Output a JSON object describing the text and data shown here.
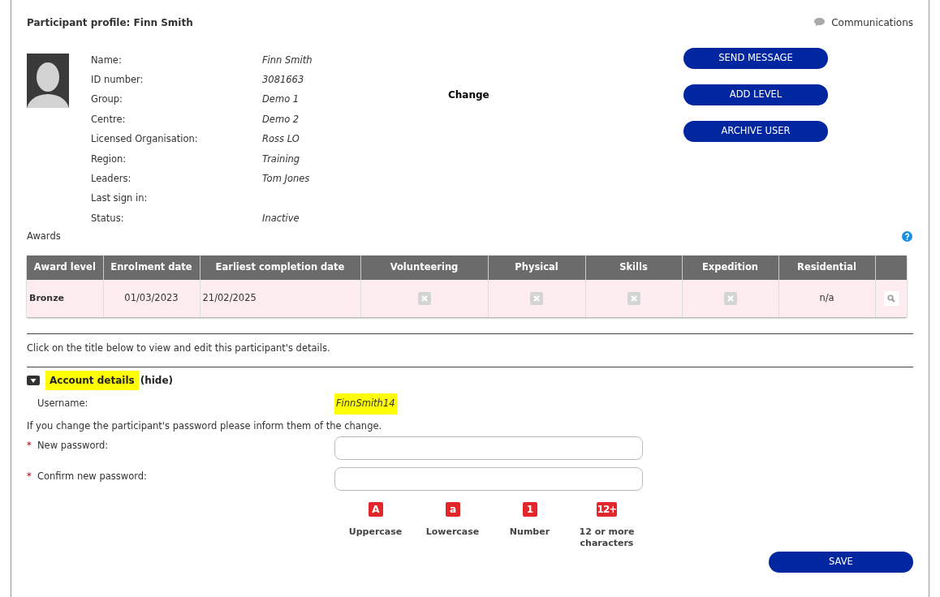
{
  "header": {
    "title": "Participant profile: Finn Smith",
    "communications": "Communications"
  },
  "profile": {
    "fields": [
      {
        "label": "Name:",
        "value": "Finn Smith"
      },
      {
        "label": "ID number:",
        "value": "3081663"
      },
      {
        "label": "Group:",
        "value": "Demo 1"
      },
      {
        "label": "Centre:",
        "value": "Demo 2"
      },
      {
        "label": "Licensed Organisation:",
        "value": "Ross LO"
      },
      {
        "label": "Region:",
        "value": "Training"
      },
      {
        "label": "Leaders:",
        "value": "Tom Jones"
      },
      {
        "label": "Last sign in:"
      },
      {
        "label": "Status:",
        "value": "Inactive"
      }
    ],
    "change_link": "Change",
    "buttons": [
      "SEND MESSAGE",
      "ADD LEVEL",
      "ARCHIVE USER"
    ]
  },
  "awards": {
    "title": "Awards",
    "columns": [
      "Award level",
      "Enrolment date",
      "Earliest completion date",
      "Volunteering",
      "Physical",
      "Skills",
      "Expedition",
      "Residential"
    ],
    "rows": [
      {
        "level": "Bronze",
        "enrolment": "01/03/2023",
        "earliest": "21/02/2025",
        "sections": [
          {
            "done": false
          },
          {
            "done": false
          },
          {
            "done": false
          },
          {
            "done": false
          }
        ],
        "residential": "n/a"
      }
    ]
  },
  "instructions": "Click on the title below to view and edit this participant's details.",
  "account": {
    "title": "Account details",
    "toggle": "(hide)",
    "expanded": true,
    "username_label": "Username:",
    "username": "FinnSmith14",
    "note": "If you change the participant's password please inform them of the change.",
    "fields": [
      {
        "marker": "*",
        "label": "New password:"
      },
      {
        "marker": "*",
        "label": "Confirm new password:"
      }
    ],
    "rules": [
      {
        "badge": "A",
        "label": "Uppercase",
        "met": false
      },
      {
        "badge": "a",
        "label": "Lowercase",
        "met": false
      },
      {
        "badge": "1",
        "label": "Number",
        "met": false
      },
      {
        "badge": "12+",
        "label": "12 or more characters",
        "met": false
      }
    ],
    "save": "SAVE"
  }
}
